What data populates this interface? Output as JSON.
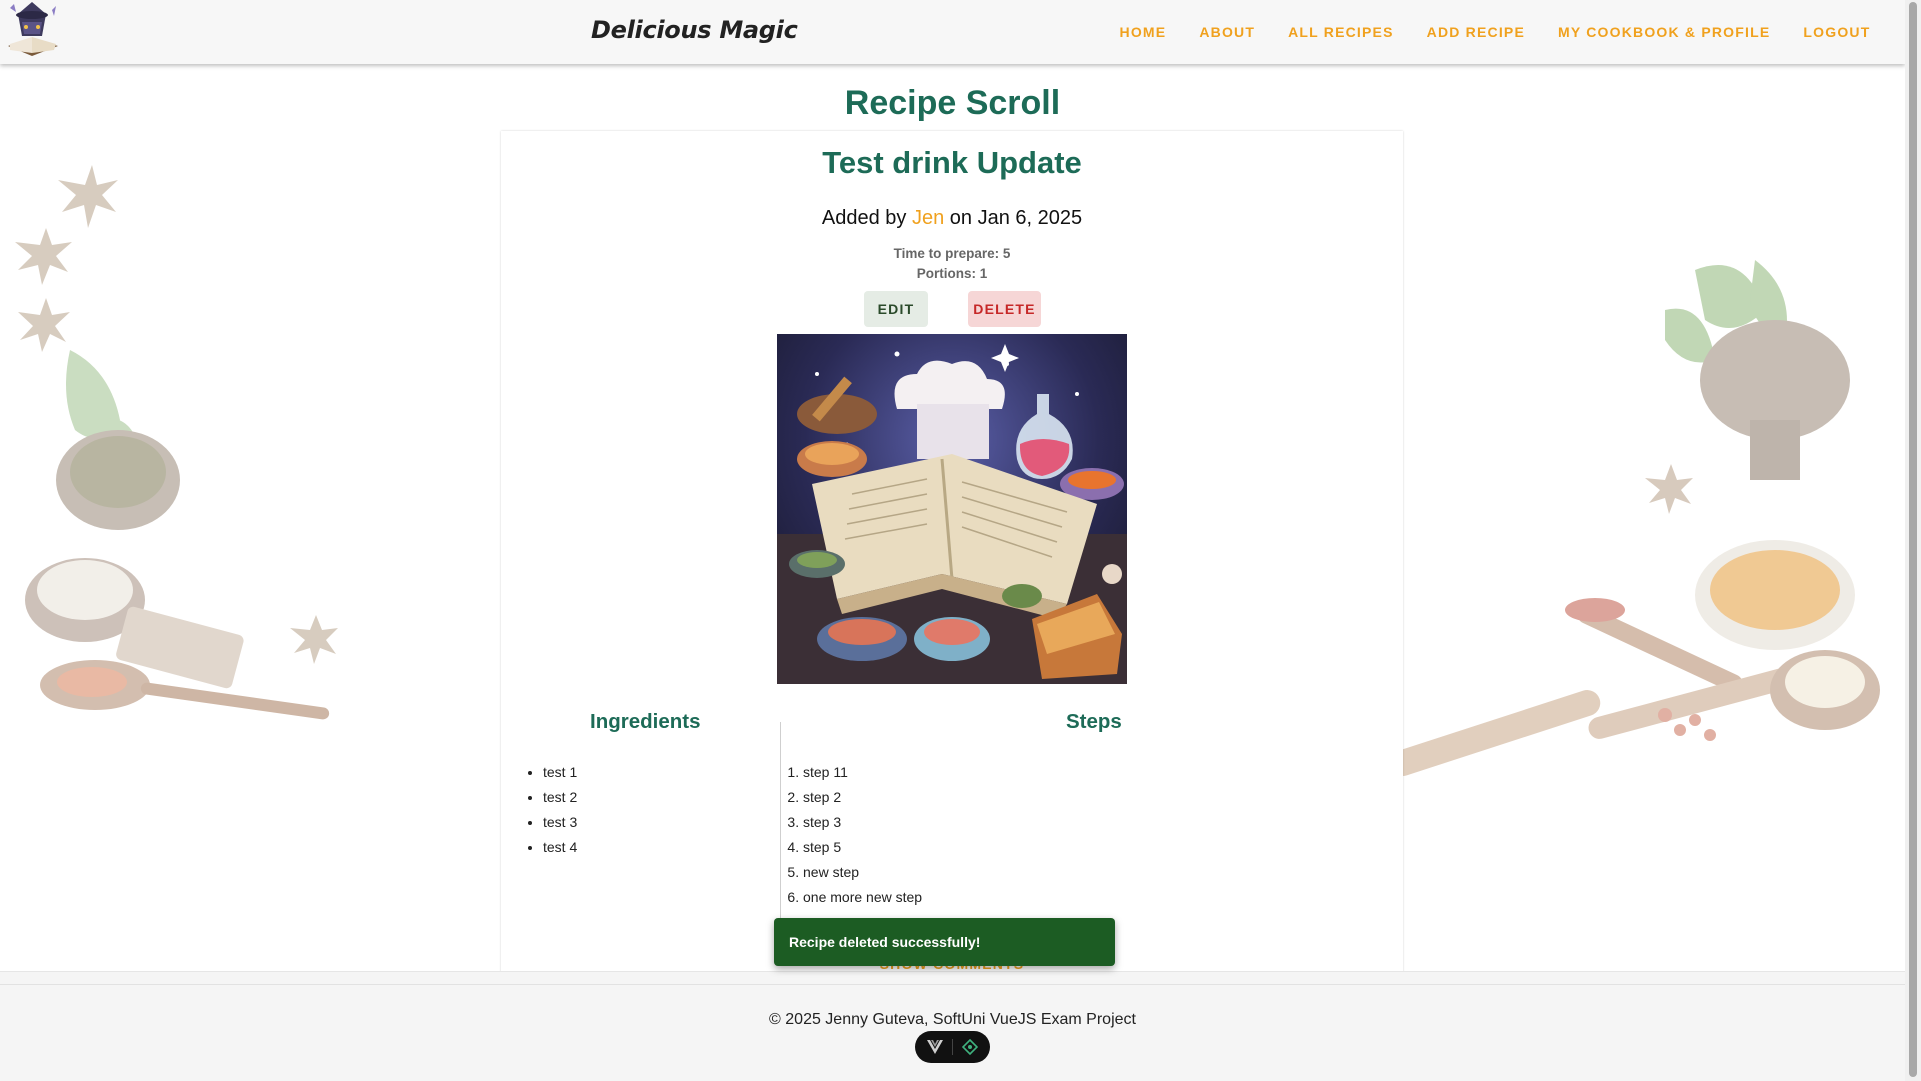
{
  "header": {
    "brand": "Delicious Magic",
    "nav": [
      "HOME",
      "ABOUT",
      "ALL RECIPES",
      "ADD RECIPE",
      "MY COOKBOOK & PROFILE",
      "LOGOUT"
    ]
  },
  "page": {
    "title": "Recipe Scroll"
  },
  "recipe": {
    "title": "Test drink Update",
    "added_prefix": "Added by",
    "author": "Jen",
    "date_text": "on Jan 6, 2025",
    "prep_label": "Time to prepare: 5",
    "portions_label": "Portions: 1",
    "edit_label": "EDIT",
    "delete_label": "DELETE",
    "ingredients_heading": "Ingredients",
    "steps_heading": "Steps",
    "ingredients": [
      "test 1",
      "test 2",
      "test 3",
      "test 4"
    ],
    "steps": [
      "step 11",
      "step 2",
      "step 3",
      "step 5",
      "new step",
      "one more new step"
    ],
    "show_comments_label": "SHOW COMMENTS"
  },
  "snackbar": {
    "message": "Recipe deleted successfully!"
  },
  "footer": {
    "copyright": "© 2025 Jenny Guteva, SoftUni VueJS Exam Project"
  },
  "colors": {
    "accent": "#f0a11e",
    "heading": "#1d6b57",
    "snackbar_bg": "#1c5c23",
    "delete": "#c62828"
  }
}
